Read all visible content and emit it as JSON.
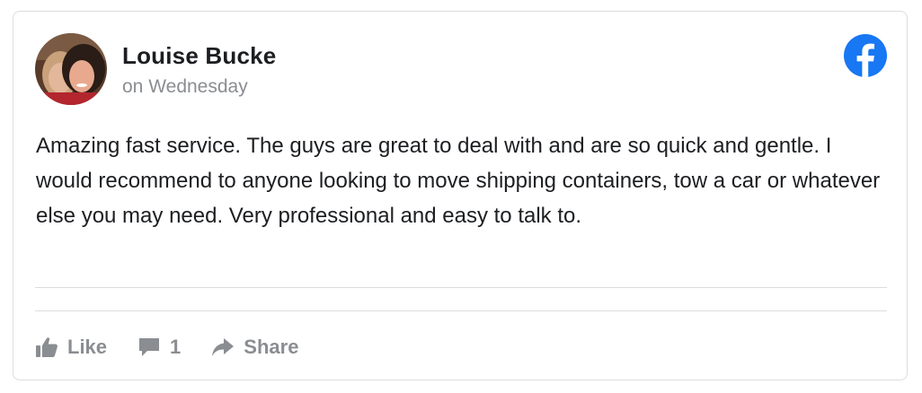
{
  "post": {
    "author_name": "Louise Bucke",
    "time": "on Wednesday",
    "text": "Amazing fast service. The guys are great to deal with and are so quick and gentle. I would recommend to anyone looking to move shipping containers, tow a car or whatever else you may need. Very professional and easy to talk to."
  },
  "actions": {
    "like_label": "Like",
    "comment_count": "1",
    "share_label": "Share"
  },
  "icons": {
    "brand": "facebook-logo-icon",
    "like": "thumbs-up-icon",
    "comment": "comment-bubble-icon",
    "share": "share-arrow-icon"
  },
  "colors": {
    "facebook_blue": "#1877f2",
    "muted_text": "#8a8d91",
    "primary_text": "#1c1e21",
    "border": "#dadde1"
  }
}
